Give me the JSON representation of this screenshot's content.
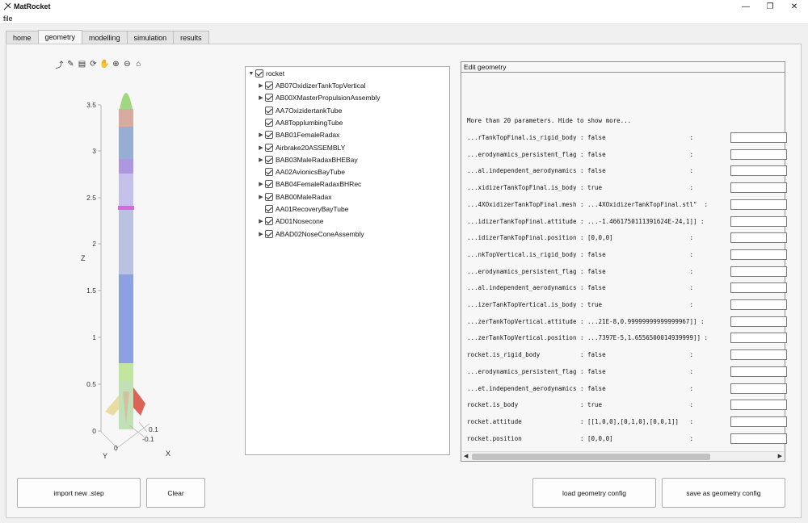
{
  "app": {
    "title": "MatRocket"
  },
  "window": {
    "minimize": "—",
    "maximize": "❐",
    "close": "✕"
  },
  "menu": {
    "file": "file"
  },
  "tabs": [
    "home",
    "geometry",
    "modelling",
    "simulation",
    "results"
  ],
  "active_tab": "geometry",
  "axes": {
    "z_label": "Z",
    "y_label": "Y",
    "x_label": "X",
    "z_ticks": [
      "3.5",
      "3",
      "2.5",
      "2",
      "1.5",
      "1",
      "0.5",
      "0"
    ],
    "y_ticks": [
      "0"
    ],
    "x_ticks": [
      "0.1",
      "-0.1"
    ]
  },
  "tree": {
    "root": "rocket",
    "items": [
      {
        "label": "AB07OxidizerTankTopVertical",
        "expandable": true
      },
      {
        "label": "AB00XMasterPropulsionAssembly",
        "expandable": true
      },
      {
        "label": "AA7OxizidertankTube",
        "expandable": false
      },
      {
        "label": "AA8TopplumbingTube",
        "expandable": false
      },
      {
        "label": "BAB01FemaleRadax",
        "expandable": true
      },
      {
        "label": "Airbrake20ASSEMBLY",
        "expandable": true
      },
      {
        "label": "BAB03MaleRadaxBHEBay",
        "expandable": true
      },
      {
        "label": "AA02AvionicsBayTube",
        "expandable": false
      },
      {
        "label": "BAB04FemaleRadaxBHRec",
        "expandable": true
      },
      {
        "label": "BAB00MaleRadax",
        "expandable": true
      },
      {
        "label": "AA01RecoveryBayTube",
        "expandable": false
      },
      {
        "label": "AD01Nosecone",
        "expandable": true
      },
      {
        "label": "ABAD02NoseConeAssembly",
        "expandable": true
      }
    ]
  },
  "edit_geometry": {
    "header": "Edit geometry",
    "note": "More than 20 parameters. Hide to show more...",
    "params": [
      "...rTankTopFinal.is_rigid_body : false                       :",
      "...erodynamics_persistent_flag : false                       :",
      "...al.independent_aerodynamics : false                       :",
      "...xidizerTankTopFinal.is_body : true                        :",
      "...4XOxidizerTankTopFinal.mesh : ...4XOxidizerTankTopFinal.stl\"  :",
      "...idizerTankTopFinal.attitude : ...-1.4661750111391624E-24,1]] :",
      "...idizerTankTopFinal.position : [0,0,0]                     :",
      "...nkTopVertical.is_rigid_body : false                       :",
      "...erodynamics_persistent_flag : false                       :",
      "...al.independent_aerodynamics : false                       :",
      "...izerTankTopVertical.is_body : true                        :",
      "...zerTankTopVertical.attitude : ...21E-8,0.99999999999999967]] :",
      "...zerTankTopVertical.position : ...7397E-5,1.6556500014939999]] :",
      "rocket.is_rigid_body           : false                       :",
      "...erodynamics_persistent_flag : false                       :",
      "...et.independent_aerodynamics : false                       :",
      "rocket.is_body                 : true                        :",
      "rocket.attitude                : [[1,0,0],[0,1,0],[0,0,1]]   :",
      "rocket.position                : [0,0,0]                     :"
    ]
  },
  "buttons": {
    "import": "import new .step",
    "clear": "Clear",
    "load": "load geometry config",
    "save": "save as geometry config"
  }
}
